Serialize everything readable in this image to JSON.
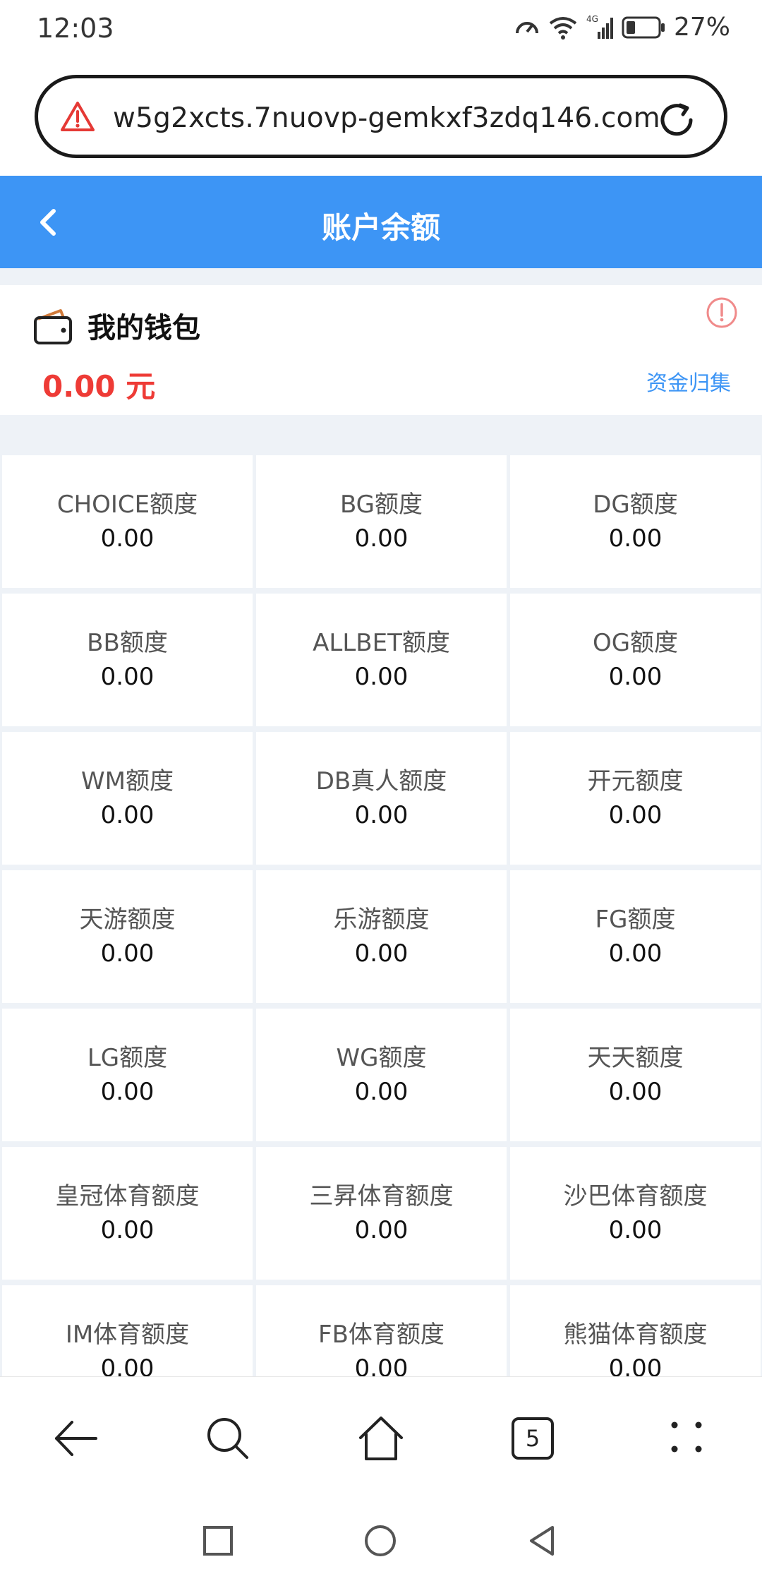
{
  "status_bar": {
    "time": "12:03",
    "battery": "27%",
    "network": "4G"
  },
  "browser": {
    "url": "w5g2xcts.7nuovp-gemkxf3zdq146.com",
    "tab_count": "5"
  },
  "header": {
    "title": "账户余额",
    "color": "#3d95f5"
  },
  "wallet": {
    "title": "我的钱包",
    "amount": "0.00 元",
    "collect_label": "资金归集",
    "amount_color": "#ee3b36"
  },
  "balances": [
    {
      "label": "CHOICE额度",
      "value": "0.00"
    },
    {
      "label": "BG额度",
      "value": "0.00"
    },
    {
      "label": "DG额度",
      "value": "0.00"
    },
    {
      "label": "BB额度",
      "value": "0.00"
    },
    {
      "label": "ALLBET额度",
      "value": "0.00"
    },
    {
      "label": "OG额度",
      "value": "0.00"
    },
    {
      "label": "WM额度",
      "value": "0.00"
    },
    {
      "label": "DB真人额度",
      "value": "0.00"
    },
    {
      "label": "开元额度",
      "value": "0.00"
    },
    {
      "label": "天游额度",
      "value": "0.00"
    },
    {
      "label": "乐游额度",
      "value": "0.00"
    },
    {
      "label": "FG额度",
      "value": "0.00"
    },
    {
      "label": "LG额度",
      "value": "0.00"
    },
    {
      "label": "WG额度",
      "value": "0.00"
    },
    {
      "label": "天天额度",
      "value": "0.00"
    },
    {
      "label": "皇冠体育额度",
      "value": "0.00"
    },
    {
      "label": "三昇体育额度",
      "value": "0.00"
    },
    {
      "label": "沙巴体育额度",
      "value": "0.00"
    },
    {
      "label": "IM体育额度",
      "value": "0.00"
    },
    {
      "label": "FB体育额度",
      "value": "0.00"
    },
    {
      "label": "熊猫体育额度",
      "value": "0.00"
    }
  ]
}
